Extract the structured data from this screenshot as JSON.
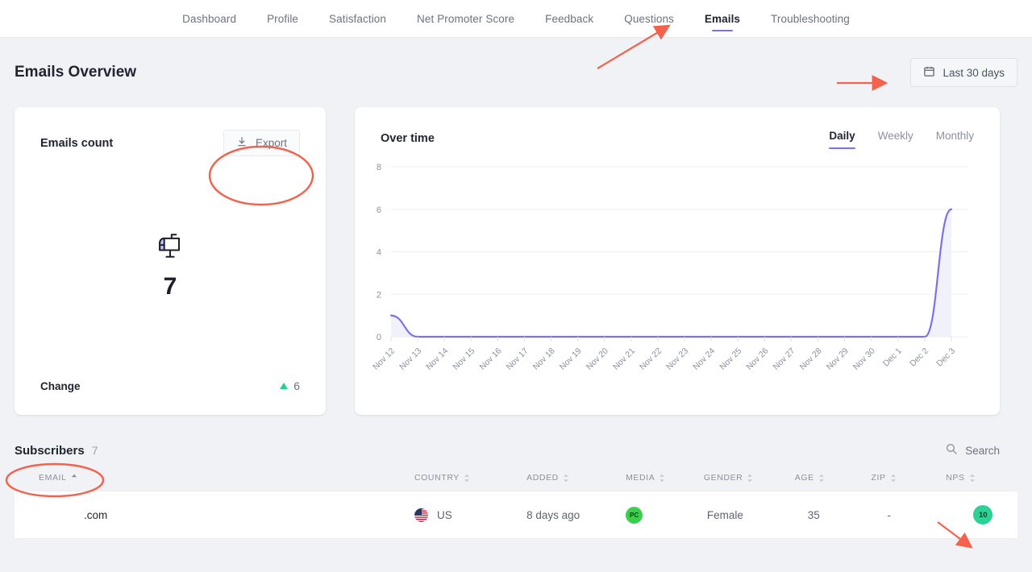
{
  "nav": {
    "items": [
      {
        "label": "Dashboard",
        "active": false
      },
      {
        "label": "Profile",
        "active": false
      },
      {
        "label": "Satisfaction",
        "active": false
      },
      {
        "label": "Net Promoter Score",
        "active": false
      },
      {
        "label": "Feedback",
        "active": false
      },
      {
        "label": "Questions",
        "active": false
      },
      {
        "label": "Emails",
        "active": true
      },
      {
        "label": "Troubleshooting",
        "active": false
      }
    ]
  },
  "header": {
    "title": "Emails Overview",
    "date_filter": "Last 30 days",
    "calendar_icon": "calendar-icon"
  },
  "emails_count_card": {
    "title": "Emails count",
    "export_label": "Export",
    "export_icon": "download-icon",
    "mailbox_icon": "mailbox-icon",
    "value": "7",
    "change_label": "Change",
    "change_value": "6",
    "change_direction": "up",
    "change_color": "#25d08a"
  },
  "over_time_card": {
    "title": "Over time",
    "tabs": [
      {
        "label": "Daily",
        "active": true
      },
      {
        "label": "Weekly",
        "active": false
      },
      {
        "label": "Monthly",
        "active": false
      }
    ]
  },
  "chart_data": {
    "type": "area",
    "title": "Over time",
    "xlabel": "",
    "ylabel": "",
    "ylim": [
      0,
      8
    ],
    "yticks": [
      0,
      2,
      4,
      6,
      8
    ],
    "grid": true,
    "legend": false,
    "line_color": "#7b72e9",
    "fill_color": "#efeefc",
    "categories": [
      "Nov 12",
      "Nov 13",
      "Nov 14",
      "Nov 15",
      "Nov 16",
      "Nov 17",
      "Nov 18",
      "Nov 19",
      "Nov 20",
      "Nov 21",
      "Nov 22",
      "Nov 23",
      "Nov 24",
      "Nov 25",
      "Nov 26",
      "Nov 27",
      "Nov 28",
      "Nov 29",
      "Nov 30",
      "Dec 1",
      "Dec 2",
      "Dec 3"
    ],
    "values": [
      1,
      0,
      0,
      0,
      0,
      0,
      0,
      0,
      0,
      0,
      0,
      0,
      0,
      0,
      0,
      0,
      0,
      0,
      0,
      0,
      0,
      6
    ]
  },
  "subscribers": {
    "title": "Subscribers",
    "count": "7",
    "search_placeholder": "Search",
    "search_icon": "search-icon",
    "columns": [
      {
        "label": "EMAIL",
        "sort": "asc"
      },
      {
        "label": "COUNTRY",
        "sort": "none"
      },
      {
        "label": "ADDED",
        "sort": "none"
      },
      {
        "label": "MEDIA",
        "sort": "none"
      },
      {
        "label": "GENDER",
        "sort": "none"
      },
      {
        "label": "AGE",
        "sort": "none"
      },
      {
        "label": "ZIP",
        "sort": "none"
      },
      {
        "label": "NPS",
        "sort": "none"
      }
    ],
    "rows": [
      {
        "email": ".com",
        "country": "US",
        "country_flag": "us-flag-icon",
        "added": "8 days ago",
        "media": "PC",
        "gender": "Female",
        "age": "35",
        "zip": "-",
        "nps": "10"
      }
    ]
  },
  "annotations": {
    "color": "#f4614c",
    "shapes": [
      {
        "name": "arrow-to-emails-tab"
      },
      {
        "name": "arrow-to-date-filter"
      },
      {
        "name": "ellipse-around-export-button"
      },
      {
        "name": "ellipse-around-subscribers-title"
      },
      {
        "name": "arrow-to-nps-badge"
      }
    ]
  }
}
